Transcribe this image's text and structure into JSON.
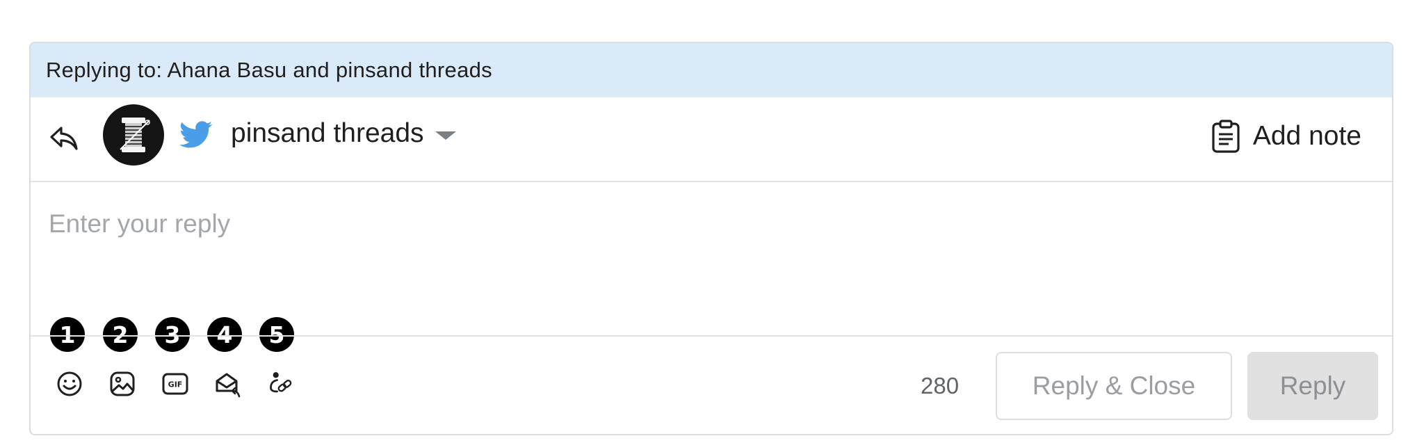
{
  "replying_to": "Replying to: Ahana Basu and pinsand threads",
  "account": {
    "name": "pinsand threads",
    "network_icon": "twitter-bird-icon",
    "avatar_icon": "thread-spool-icon"
  },
  "add_note_label": "Add note",
  "reply": {
    "placeholder": "Enter your reply",
    "value": ""
  },
  "badges": [
    "1",
    "2",
    "3",
    "4",
    "5"
  ],
  "toolbar": {
    "tools": [
      "emoji-icon",
      "image-icon",
      "gif-icon",
      "email-reply-icon",
      "user-link-icon"
    ]
  },
  "char_count": "280",
  "buttons": {
    "reply_close": "Reply & Close",
    "reply": "Reply"
  },
  "colors": {
    "replying_bar_bg": "#daeaf8",
    "twitter_blue": "#4a9ee8",
    "badge_bg": "#000000",
    "reply_button_bg": "#e1e1e1"
  }
}
